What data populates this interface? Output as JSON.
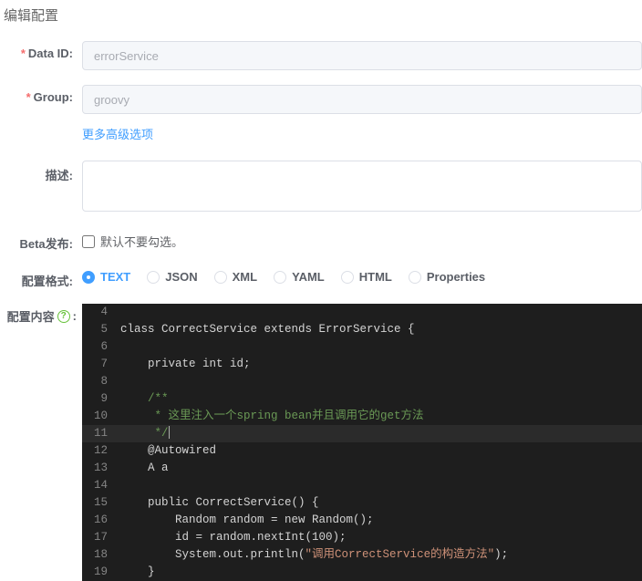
{
  "page_title": "编辑配置",
  "labels": {
    "data_id": "Data ID:",
    "group": "Group:",
    "desc": "描述:",
    "beta": "Beta发布:",
    "format": "配置格式:",
    "content": "配置内容"
  },
  "data_id_value": "errorService",
  "group_value": "groovy",
  "more_options": "更多高级选项",
  "desc_value": "",
  "beta_checked": false,
  "beta_text": "默认不要勾选。",
  "formats": [
    "TEXT",
    "JSON",
    "XML",
    "YAML",
    "HTML",
    "Properties"
  ],
  "format_selected": "TEXT",
  "editor_start_line": 4,
  "editor_highlight_line": 11,
  "editor_lines": [
    {
      "n": 4,
      "segs": []
    },
    {
      "n": 5,
      "segs": [
        {
          "t": "class CorrectService extends ErrorService {"
        }
      ]
    },
    {
      "n": 6,
      "segs": []
    },
    {
      "n": 7,
      "segs": [
        {
          "t": "    private int id;"
        }
      ]
    },
    {
      "n": 8,
      "segs": []
    },
    {
      "n": 9,
      "segs": [
        {
          "t": "    ",
          "c": ""
        },
        {
          "t": "/**",
          "c": "cm"
        }
      ]
    },
    {
      "n": 10,
      "segs": [
        {
          "t": "     ",
          "c": ""
        },
        {
          "t": "* 这里注入一个spring bean并且调用它的get方法",
          "c": "cm"
        }
      ]
    },
    {
      "n": 11,
      "segs": [
        {
          "t": "     ",
          "c": ""
        },
        {
          "t": "*/",
          "c": "cm"
        }
      ],
      "cursor": true
    },
    {
      "n": 12,
      "segs": [
        {
          "t": "    @Autowired"
        }
      ]
    },
    {
      "n": 13,
      "segs": [
        {
          "t": "    A a"
        }
      ]
    },
    {
      "n": 14,
      "segs": []
    },
    {
      "n": 15,
      "segs": [
        {
          "t": "    public CorrectService() {"
        }
      ]
    },
    {
      "n": 16,
      "segs": [
        {
          "t": "        Random random = new Random();"
        }
      ]
    },
    {
      "n": 17,
      "segs": [
        {
          "t": "        id = random.nextInt(100);"
        }
      ]
    },
    {
      "n": 18,
      "segs": [
        {
          "t": "        System.out.println("
        },
        {
          "t": "\"调用CorrectService的构造方法\"",
          "c": "str"
        },
        {
          "t": ");"
        }
      ]
    },
    {
      "n": 19,
      "segs": [
        {
          "t": "    }"
        }
      ]
    }
  ]
}
